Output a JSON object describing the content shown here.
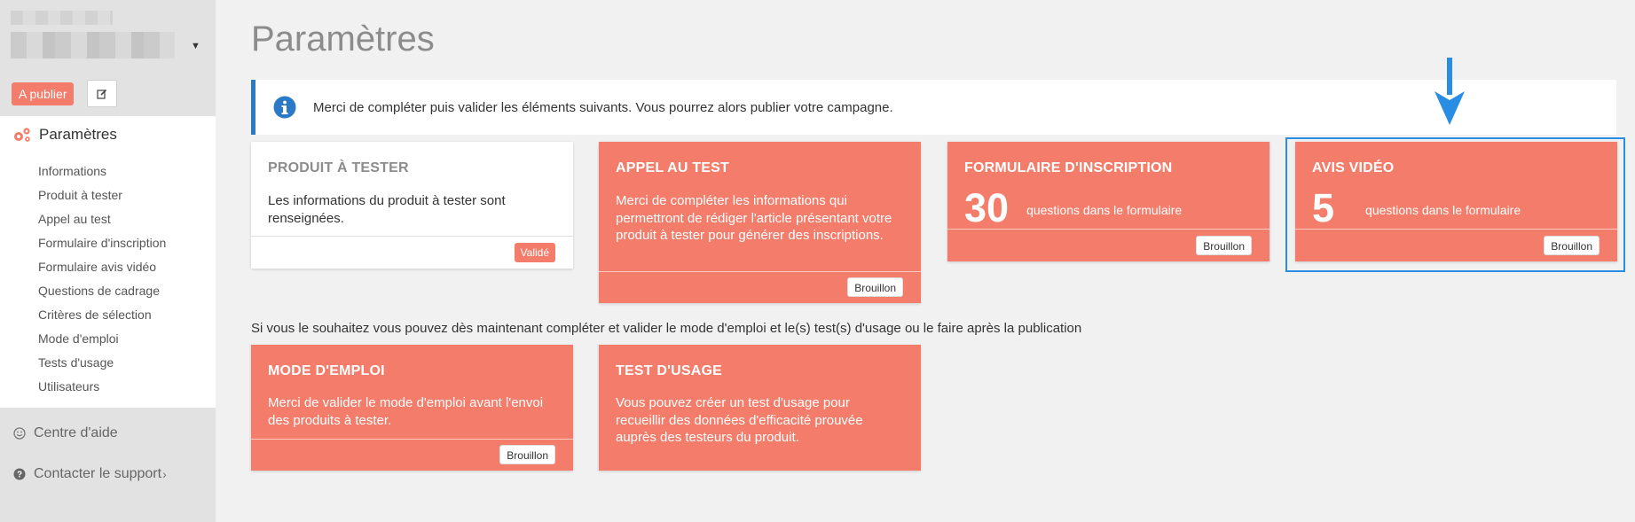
{
  "sidebar": {
    "publish_button": "A publier",
    "section_title": "Paramètres",
    "items": [
      "Informations",
      "Produit à tester",
      "Appel au test",
      "Formulaire d'inscription",
      "Formulaire avis vidéo",
      "Questions de cadrage",
      "Critères de sélection",
      "Mode d'emploi",
      "Tests d'usage",
      "Utilisateurs"
    ],
    "help_link": "Centre d'aide",
    "support_link": "Contacter le support"
  },
  "page": {
    "title": "Paramètres",
    "info_message": "Merci de compléter puis valider les éléments suivants. Vous pourrez alors publier votre campagne.",
    "optional_note": "Si vous le souhaitez vous pouvez dès maintenant compléter et valider le mode d'emploi et le(s) test(s) d'usage ou le faire après la publication"
  },
  "cards": {
    "produit": {
      "title": "PRODUIT À TESTER",
      "body": "Les informations du produit à tester sont renseignées.",
      "status": "Validé"
    },
    "appel": {
      "title": "APPEL AU TEST",
      "body": "Merci de compléter les informations qui permettront de rédiger l'article présentant votre produit à tester pour générer des inscriptions.",
      "status": "Brouillon"
    },
    "formulaire": {
      "title": "FORMULAIRE D'INSCRIPTION",
      "count": "30",
      "count_label": "questions dans le formulaire",
      "status": "Brouillon"
    },
    "avis": {
      "title": "AVIS VIDÉO",
      "count": "5",
      "count_label": "questions dans le formulaire",
      "status": "Brouillon"
    },
    "mode": {
      "title": "MODE D'EMPLOI",
      "body": "Merci de valider le mode d'emploi avant l'envoi des produits à tester.",
      "status": "Brouillon"
    },
    "test": {
      "title": "TEST D'USAGE",
      "body": "Vous pouvez créer un test d'usage pour recueillir des données d'efficacité prouvée auprès des testeurs du produit."
    }
  },
  "colors": {
    "accent": "#f47c6a",
    "info_border": "#2a7ac7",
    "highlight": "#2a8de4"
  }
}
